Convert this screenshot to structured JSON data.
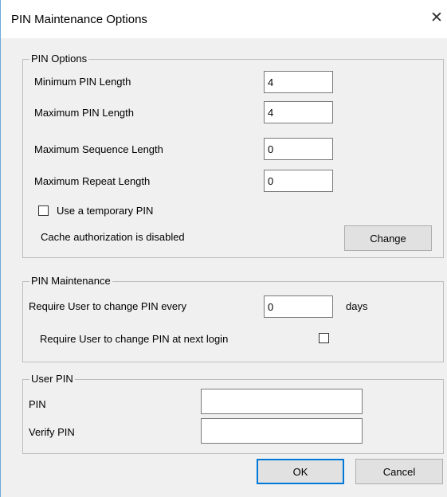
{
  "window": {
    "title": "PIN Maintenance Options",
    "close_glyph": "✕"
  },
  "pin_options": {
    "legend": "PIN Options",
    "min_length_label": "Minimum PIN Length",
    "min_length_value": "4",
    "max_length_label": "Maximum PIN Length",
    "max_length_value": "4",
    "max_sequence_label": "Maximum Sequence Length",
    "max_sequence_value": "0",
    "max_repeat_label": "Maximum Repeat Length",
    "max_repeat_value": "0",
    "temp_pin_label": "Use a temporary PIN",
    "temp_pin_checked": false,
    "cache_status": "Cache authorization is disabled",
    "change_button": "Change"
  },
  "pin_maintenance": {
    "legend": "PIN Maintenance",
    "change_every_label": "Require User to change PIN every",
    "change_every_value": "0",
    "days_label": "days",
    "next_login_label": "Require User to change PIN at next login",
    "next_login_checked": false
  },
  "user_pin": {
    "legend": "User PIN",
    "pin_label": "PIN",
    "pin_value": "",
    "verify_label": "Verify PIN",
    "verify_value": ""
  },
  "footer": {
    "ok_button": "OK",
    "cancel_button": "Cancel"
  }
}
